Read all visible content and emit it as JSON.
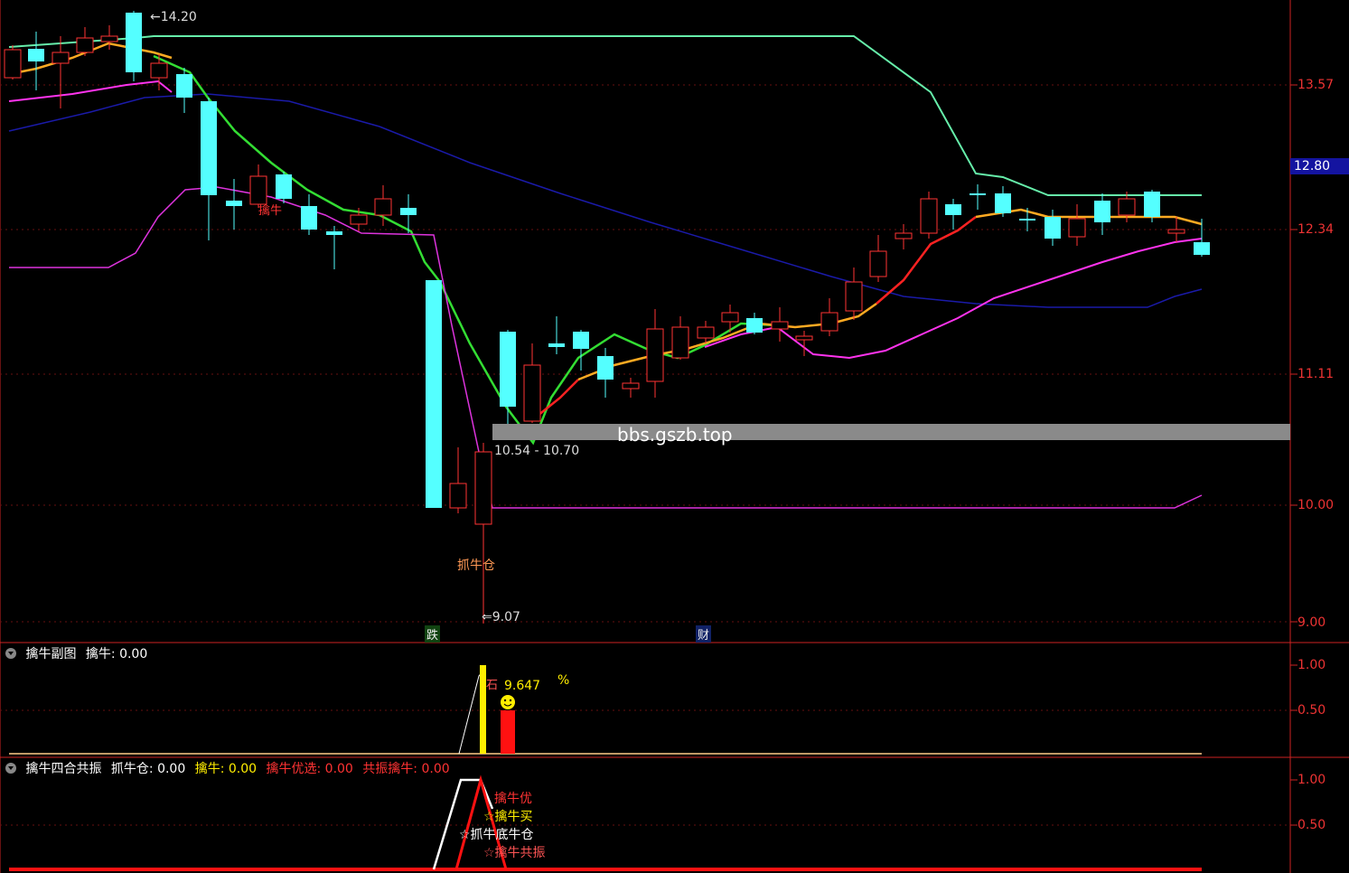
{
  "colors": {
    "background": "#000000",
    "axis": "#cc2222",
    "up_candle": "#ff3333",
    "down_candle": "#54ffff",
    "ma_green": "#33dd33",
    "ma_teal": "#66eeaa",
    "ma_blue": "#1a1aa8",
    "ma_magenta": "#dd33dd",
    "ma_red_yellow": "#ff2222",
    "yellow": "#ffee00",
    "pink_orange": "#ff8844"
  },
  "main_panel": {
    "high_label": "14.20",
    "low_label": "9.07",
    "range_label": "10.54 - 10.70",
    "signal_label": "抓牛仓",
    "small_label": "擒牛",
    "watermark_url": "bbs.gszb.top",
    "markers": {
      "die": "跌",
      "cai": "财"
    },
    "current_price": "12.80",
    "y_axis": [
      "13.57",
      "12.34",
      "11.11",
      "10.00",
      "9.00"
    ]
  },
  "sub_panel_1": {
    "title": "擒牛副图",
    "value_label": "擒牛:",
    "value": "0.00",
    "annotation_value": "9.647",
    "annotation_pct": "%",
    "y_axis": [
      "1.00",
      "0.50"
    ]
  },
  "sub_panel_2": {
    "title": "擒牛四合共振",
    "items": [
      {
        "label": "抓牛仓:",
        "value": "0.00",
        "color": "#ffffff"
      },
      {
        "label": "擒牛:",
        "value": "0.00",
        "color": "#ffee00"
      },
      {
        "label": "擒牛优选:",
        "value": "0.00",
        "color": "#ff3333"
      },
      {
        "label": "共振擒牛:",
        "value": "0.00",
        "color": "#ff3333"
      }
    ],
    "legend": [
      "擒牛优",
      "☆擒牛买",
      "☆抓牛底牛仓",
      "☆擒牛共振"
    ],
    "y_axis": [
      "1.00",
      "0.50"
    ]
  }
}
